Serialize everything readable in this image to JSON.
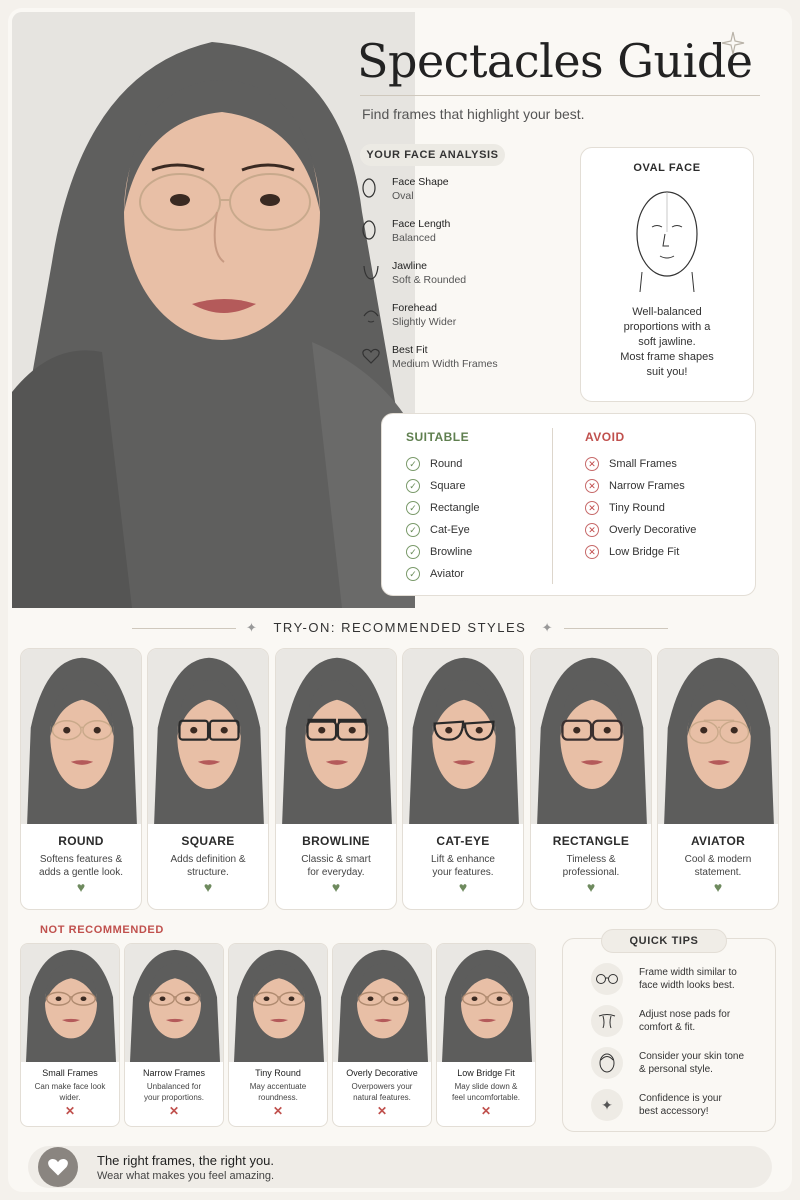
{
  "title": "Spectacles Guide",
  "subtitle": "Find frames that highlight your best.",
  "analysis": {
    "heading": "YOUR FACE ANALYSIS",
    "rows": [
      {
        "icon": "oval-face-icon",
        "label": "Face Shape",
        "value": "Oval"
      },
      {
        "icon": "face-length-icon",
        "label": "Face Length",
        "value": "Balanced"
      },
      {
        "icon": "jawline-icon",
        "label": "Jawline",
        "value": "Soft & Rounded"
      },
      {
        "icon": "forehead-icon",
        "label": "Forehead",
        "value": "Slightly Wider"
      },
      {
        "icon": "heart-icon",
        "label": "Best Fit",
        "value": "Medium Width Frames"
      }
    ]
  },
  "oval_card": {
    "heading": "OVAL FACE",
    "desc_lines": [
      "Well-balanced",
      "proportions with a",
      "soft jawline.",
      "Most frame shapes",
      "suit you!"
    ]
  },
  "suitable": {
    "heading": "SUITABLE",
    "items": [
      "Round",
      "Square",
      "Rectangle",
      "Cat-Eye",
      "Browline",
      "Aviator"
    ],
    "color": "#5f7f4f"
  },
  "avoid": {
    "heading": "AVOID",
    "items": [
      "Small Frames",
      "Narrow Frames",
      "Tiny Round",
      "Overly Decorative",
      "Low Bridge Fit"
    ],
    "color": "#c0504d"
  },
  "tryon": {
    "heading": "TRY-ON: RECOMMENDED STYLES",
    "styles": [
      {
        "name": "ROUND",
        "line1": "Softens features &",
        "line2": "adds a gentle look.",
        "frame": "round",
        "color": "#c9a98a"
      },
      {
        "name": "SQUARE",
        "line1": "Adds definition &",
        "line2": "structure.",
        "frame": "square",
        "color": "#2a2a2a"
      },
      {
        "name": "BROWLINE",
        "line1": "Classic & smart",
        "line2": "for everyday.",
        "frame": "browline",
        "color": "#2a2a2a"
      },
      {
        "name": "CAT-EYE",
        "line1": "Lift & enhance",
        "line2": "your features.",
        "frame": "cateye",
        "color": "#2a2a2a"
      },
      {
        "name": "RECTANGLE",
        "line1": "Timeless &",
        "line2": "professional.",
        "frame": "rect",
        "color": "#3a3030"
      },
      {
        "name": "AVIATOR",
        "line1": "Cool & modern",
        "line2": "statement.",
        "frame": "aviator",
        "color": "#c9a98a"
      }
    ]
  },
  "not_recommended": {
    "heading": "NOT RECOMMENDED",
    "items": [
      {
        "name": "Small Frames",
        "line1": "Can make face look",
        "line2": "wider."
      },
      {
        "name": "Narrow Frames",
        "line1": "Unbalanced for",
        "line2": "your proportions."
      },
      {
        "name": "Tiny Round",
        "line1": "May accentuate",
        "line2": "roundness."
      },
      {
        "name": "Overly Decorative",
        "line1": "Overpowers your",
        "line2": "natural features."
      },
      {
        "name": "Low Bridge Fit",
        "line1": "May slide down &",
        "line2": "feel uncomfortable."
      }
    ]
  },
  "tips": {
    "heading": "QUICK TIPS",
    "items": [
      {
        "icon": "glasses-icon",
        "line1": "Frame width similar to",
        "line2": "face width looks best."
      },
      {
        "icon": "nose-pads-icon",
        "line1": "Adjust nose pads for",
        "line2": "comfort & fit."
      },
      {
        "icon": "face-icon",
        "line1": "Consider your skin tone",
        "line2": "& personal style."
      },
      {
        "icon": "sparkle-icon",
        "line1": "Confidence is your",
        "line2": "best accessory!"
      }
    ]
  },
  "footer": {
    "line1": "The right frames, the right you.",
    "line2": "Wear what makes you feel amazing."
  },
  "colors": {
    "accent_green": "#6e8a5e",
    "accent_red": "#c0504d",
    "hijab": "#5d5d5c"
  }
}
